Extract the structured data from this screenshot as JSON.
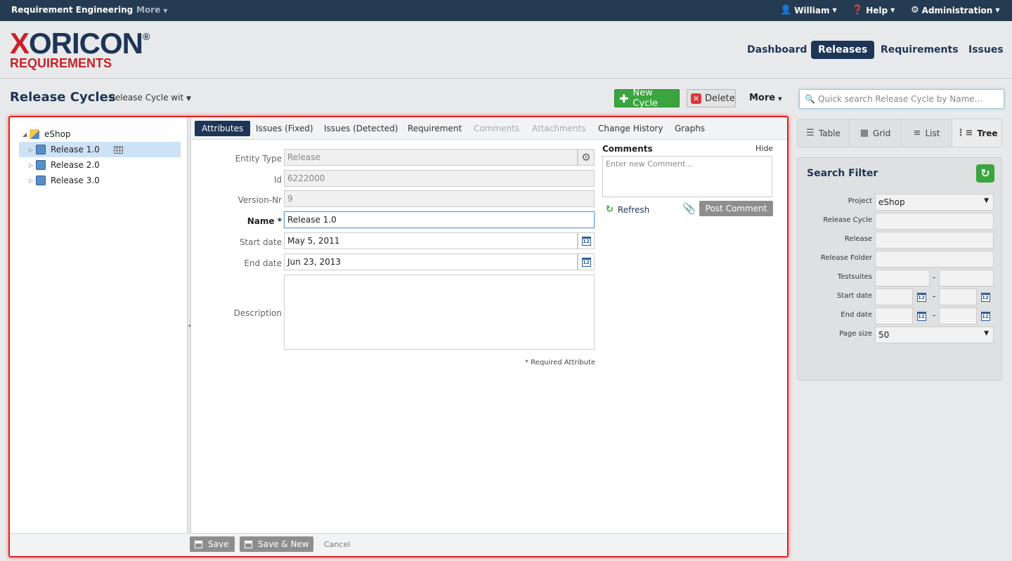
{
  "topbar": {
    "app_title": "Requirement Engineering",
    "more": "More",
    "user": "William",
    "help": "Help",
    "administration": "Administration"
  },
  "logo": {
    "brand_x": "X",
    "brand_rest": "ORICON",
    "registered": "®",
    "subtitle": "REQUIREMENTS"
  },
  "mainnav": {
    "dashboard": "Dashboard",
    "releases": "Releases",
    "requirements": "Requirements",
    "issues": "Issues"
  },
  "toolbar": {
    "page_title": "Release Cycles",
    "cycle_select": "Release Cycle wit",
    "new_cycle": "New Cycle",
    "delete": "Delete",
    "more": "More",
    "search_placeholder": "Quick search Release Cycle by Name..."
  },
  "tree": {
    "root": "eShop",
    "items": [
      {
        "label": "Release 1.0"
      },
      {
        "label": "Release 2.0"
      },
      {
        "label": "Release 3.0"
      }
    ]
  },
  "tabs": {
    "attributes": "Attributes",
    "issues_fixed": "Issues (Fixed)",
    "issues_detected": "Issues (Detected)",
    "requirement": "Requirement",
    "comments": "Comments",
    "attachments": "Attachments",
    "change_history": "Change History",
    "graphs": "Graphs"
  },
  "form": {
    "entity_type_label": "Entity Type",
    "entity_type_value": "Release",
    "id_label": "Id",
    "id_value": "6222000",
    "version_label": "Version-Nr",
    "version_value": "9",
    "name_label": "Name *",
    "name_value": "Release 1.0",
    "start_label": "Start date",
    "start_value": "May 5, 2011",
    "end_label": "End date",
    "end_value": "Jun 23, 2013",
    "description_label": "Description",
    "required_note": "* Required Attribute",
    "calendar_day": "12"
  },
  "comments": {
    "title": "Comments",
    "hide": "Hide",
    "placeholder": "Enter new Comment...",
    "refresh": "Refresh",
    "post": "Post Comment"
  },
  "footer": {
    "save": "Save",
    "save_new": "Save & New",
    "cancel": "Cancel"
  },
  "views": {
    "table": "Table",
    "grid": "Grid",
    "list": "List",
    "tree": "Tree"
  },
  "filter": {
    "title": "Search Filter",
    "project_label": "Project",
    "project_value": "eShop",
    "release_cycle_label": "Release Cycle",
    "release_label": "Release",
    "release_folder_label": "Release Folder",
    "testsuites_label": "Testsuites",
    "start_label": "Start date",
    "end_label": "End date",
    "page_size_label": "Page size",
    "page_size_value": "50",
    "dash": "-"
  }
}
